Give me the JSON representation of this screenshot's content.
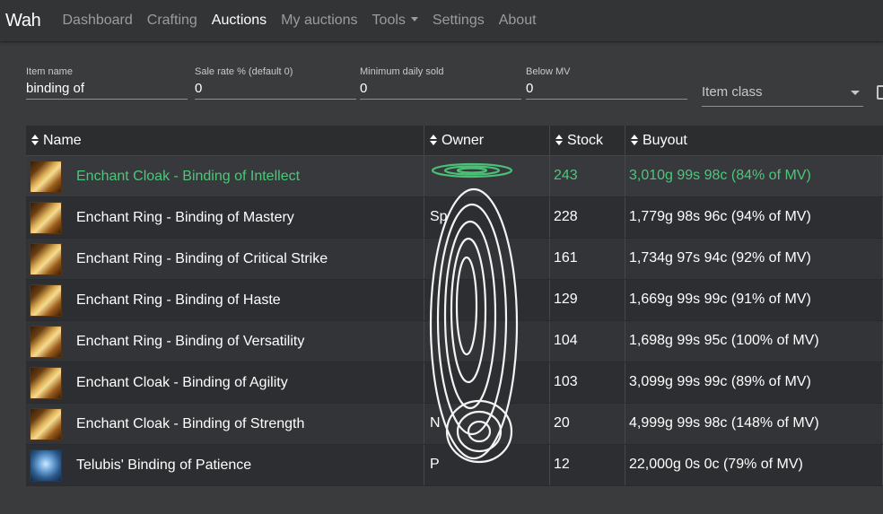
{
  "nav": {
    "brand": "Wah",
    "links": [
      "Dashboard",
      "Crafting",
      "Auctions",
      "My auctions",
      "Tools",
      "Settings",
      "About"
    ]
  },
  "filters": {
    "item_name": {
      "label": "Item name",
      "value": "binding of"
    },
    "sale_rate": {
      "label": "Sale rate % (default 0)",
      "value": "0"
    },
    "min_daily_sold": {
      "label": "Minimum daily sold",
      "value": "0"
    },
    "below_mv": {
      "label": "Below MV",
      "value": "0"
    },
    "item_class": {
      "placeholder": "Item class"
    }
  },
  "table": {
    "columns": [
      "Name",
      "Owner",
      "Stock",
      "Buyout"
    ],
    "rows": [
      {
        "name": "Enchant Cloak - Binding of Intellect",
        "owner": "",
        "stock": "243",
        "buyout": "3,010g 99s 98c (84% of MV)",
        "icon": "scroll-icon",
        "highlight": true
      },
      {
        "name": "Enchant Ring - Binding of Mastery",
        "owner": "Sp",
        "stock": "228",
        "buyout": "1,779g 98s 96c (94% of MV)",
        "icon": "scroll-icon"
      },
      {
        "name": "Enchant Ring - Binding of Critical Strike",
        "owner": "",
        "stock": "161",
        "buyout": "1,734g 97s 94c (92% of MV)",
        "icon": "scroll-icon"
      },
      {
        "name": "Enchant Ring - Binding of Haste",
        "owner": "",
        "stock": "129",
        "buyout": "1,669g 99s 99c (91% of MV)",
        "icon": "scroll-icon"
      },
      {
        "name": "Enchant Ring - Binding of Versatility",
        "owner": "",
        "stock": "104",
        "buyout": "1,698g 99s 95c (100% of MV)",
        "icon": "scroll-icon"
      },
      {
        "name": "Enchant Cloak - Binding of Agility",
        "owner": "",
        "stock": "103",
        "buyout": "3,099g 99s 99c (89% of MV)",
        "icon": "scroll-icon"
      },
      {
        "name": "Enchant Cloak - Binding of Strength",
        "owner": "N",
        "stock": "20",
        "buyout": "4,999g 99s 98c (148% of MV)",
        "icon": "scroll-icon"
      },
      {
        "name": "Telubis' Binding of Patience",
        "owner": "P",
        "stock": "12",
        "buyout": "22,000g 0s 0c (79% of MV)",
        "icon": "gem-icon"
      }
    ]
  },
  "colors": {
    "highlight": "#4cc77a",
    "background": "#3a3b3d",
    "navbar": "#333436"
  }
}
